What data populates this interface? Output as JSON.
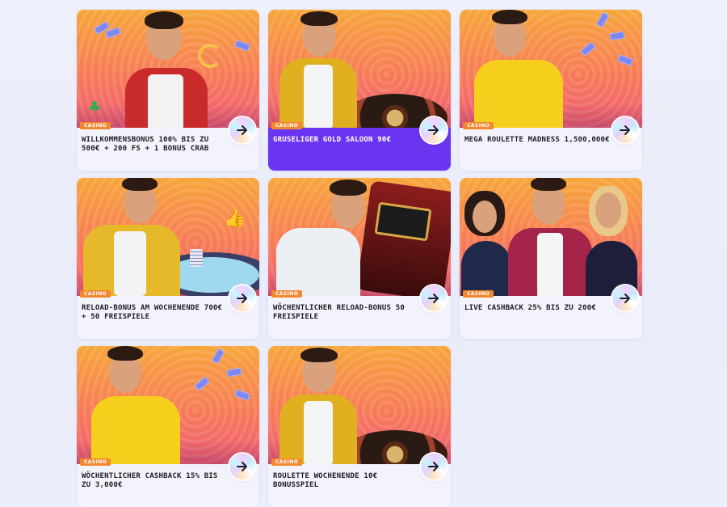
{
  "cards": [
    {
      "tag": "CASINO",
      "title": "WILLKOMMENSBONUS 100% BIS ZU 500€ + 200 FS + 1 BONUS CRAB",
      "active": false
    },
    {
      "tag": "CASINO",
      "title": "GRUSELIGER GOLD SALOON 90€",
      "active": true
    },
    {
      "tag": "CASINO",
      "title": "MEGA ROULETTE MADNESS 1,500,000€",
      "active": false
    },
    {
      "tag": "CASINO",
      "title": "RELOAD-BONUS AM WOCHENENDE 700€ + 50 FREISPIELE",
      "active": false
    },
    {
      "tag": "CASINO",
      "title": "WÖCHENTLICHER RELOAD-BONUS 50 FREISPIELE",
      "active": false
    },
    {
      "tag": "CASINO",
      "title": "LIVE CASHBACK 25% BIS ZU 200€",
      "active": false
    },
    {
      "tag": "CASINO",
      "title": "WÖCHENTLICHER CASHBACK 15% BIS ZU 3,000€",
      "active": false
    },
    {
      "tag": "CASINO",
      "title": "ROULETTE WOCHENENDE 10€ BONUSSPIEL",
      "active": false
    }
  ],
  "icons": {
    "arrow": "arrow-right-icon"
  },
  "colors": {
    "accent": "#6a35f0",
    "tag": "#f2882f",
    "card_bg": "#f3f4fb"
  }
}
